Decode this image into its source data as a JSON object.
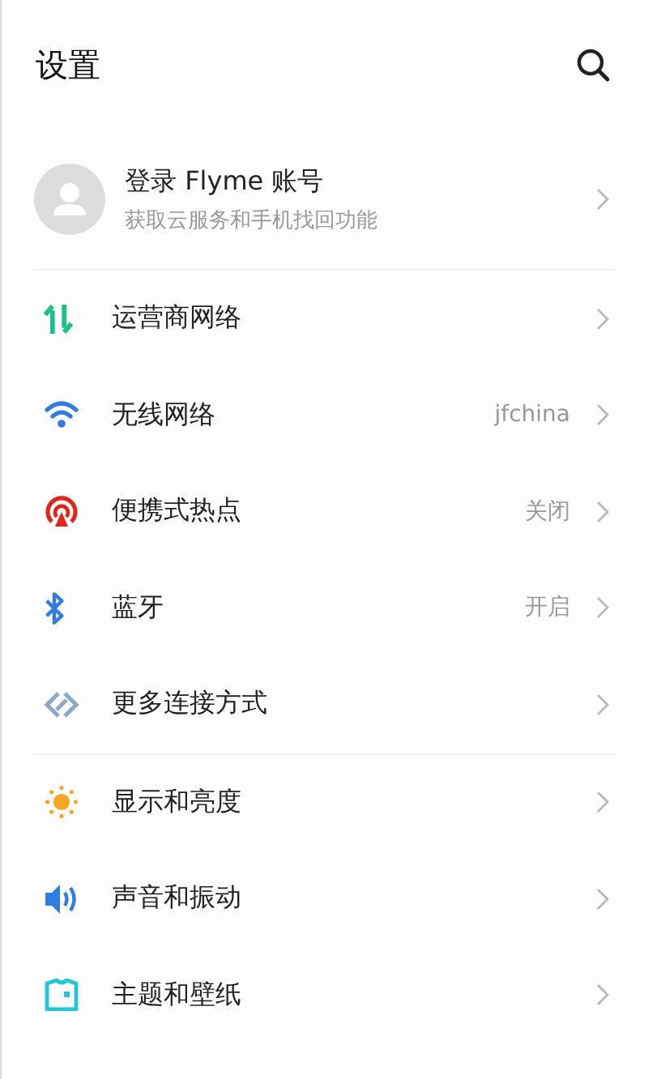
{
  "header": {
    "title": "设置"
  },
  "account": {
    "title": "登录 Flyme 账号",
    "subtitle": "获取云服务和手机找回功能"
  },
  "groups": [
    {
      "items": [
        {
          "label": "运营商网络"
        },
        {
          "label": "无线网络",
          "value": "jfchina"
        },
        {
          "label": "便携式热点",
          "value": "关闭"
        },
        {
          "label": "蓝牙",
          "value": "开启"
        },
        {
          "label": "更多连接方式"
        }
      ]
    },
    {
      "items": [
        {
          "label": "显示和亮度"
        },
        {
          "label": "声音和振动"
        },
        {
          "label": "主题和壁纸"
        }
      ]
    }
  ]
}
